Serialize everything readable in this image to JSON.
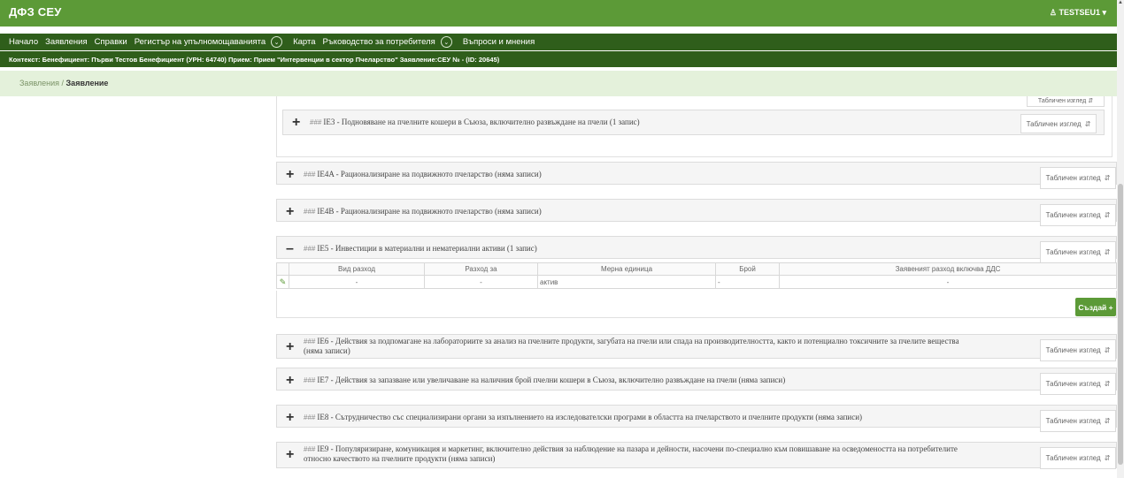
{
  "header": {
    "brand": "ДФЗ СЕУ",
    "user": "♙ TESTSEU1 ▾"
  },
  "nav": {
    "items": [
      "Начало",
      "Заявления",
      "Справки",
      "Регистър на упълномощаванията",
      "Карта",
      "Ръководство за потребителя",
      "Въпроси и мнения"
    ],
    "dropdown_glyph": "⌄"
  },
  "context": {
    "text": "Контекст: Бенефициент: Първи Тестов Бенефициент (УРН: 64740) Прием: Прием \"Интервенции в сектор Пчеларство\" Заявление:СЕУ № - (ID: 20645)"
  },
  "breadcrumb": {
    "parent": "Заявления",
    "separator": " / ",
    "current": "Заявление"
  },
  "table_view_label": "Табличен изглед",
  "table_view_icon": "⇵",
  "hash_glyph": "###",
  "sections": {
    "ie_partial_btn": "Табличен изглед ⇵",
    "ie3": {
      "toggle": "+",
      "title": "IE3 - Подновяване на пчелните кошери в Съюза, включително развъждане на пчели (1 запис)"
    },
    "ie4a": {
      "toggle": "+",
      "title": "IE4A - Рационализиране на подвижното пчеларство (няма записи)"
    },
    "ie4b": {
      "toggle": "+",
      "title": "IE4B - Рационализиране на подвижното пчеларство (няма записи)"
    },
    "ie5": {
      "toggle": "–",
      "title": "IE5 - Инвестиции в материални и нематериални активи (1 запис)"
    },
    "ie6": {
      "toggle": "+",
      "title": "IE6 - Действия за подпомагане на лабораториите за анализ на пчелните продукти, загубата на пчели или спада на производителността, както и потенциално токсичните за пчелите вещества (няма записи)"
    },
    "ie7": {
      "toggle": "+",
      "title": "IE7 - Действия за запазване или увеличаване на наличния брой пчелни кошери в Съюза, включително развъждане на пчели (няма записи)"
    },
    "ie8": {
      "toggle": "+",
      "title": "IE8 - Сътрудничество със специализирани органи за изпълнението на изследователски програми в областта на пчеларството и пчелните продукти (няма записи)"
    },
    "ie9": {
      "toggle": "+",
      "title": "IE9 - Популяризиране, комуникация и маркетинг, включително действия за наблюдение на пазара и дейности, насочени по-специално към повишаване на осведомеността на потребителите относно качеството на пчелните продукти (няма записи)"
    }
  },
  "ie5_table": {
    "columns": [
      "Вид разход",
      "Разход за",
      "Мерна единица",
      "Брой",
      "Заявеният разход включва ДДС"
    ],
    "row": {
      "edit_icon": "✎",
      "cells": [
        "-",
        "-",
        "актив",
        "-",
        "-"
      ]
    }
  },
  "create_button": "Създай +",
  "colors": {
    "brand_green": "#5c9a37",
    "dark_green": "#2f5e1b",
    "breadcrumb_bg": "#e4f1db"
  }
}
